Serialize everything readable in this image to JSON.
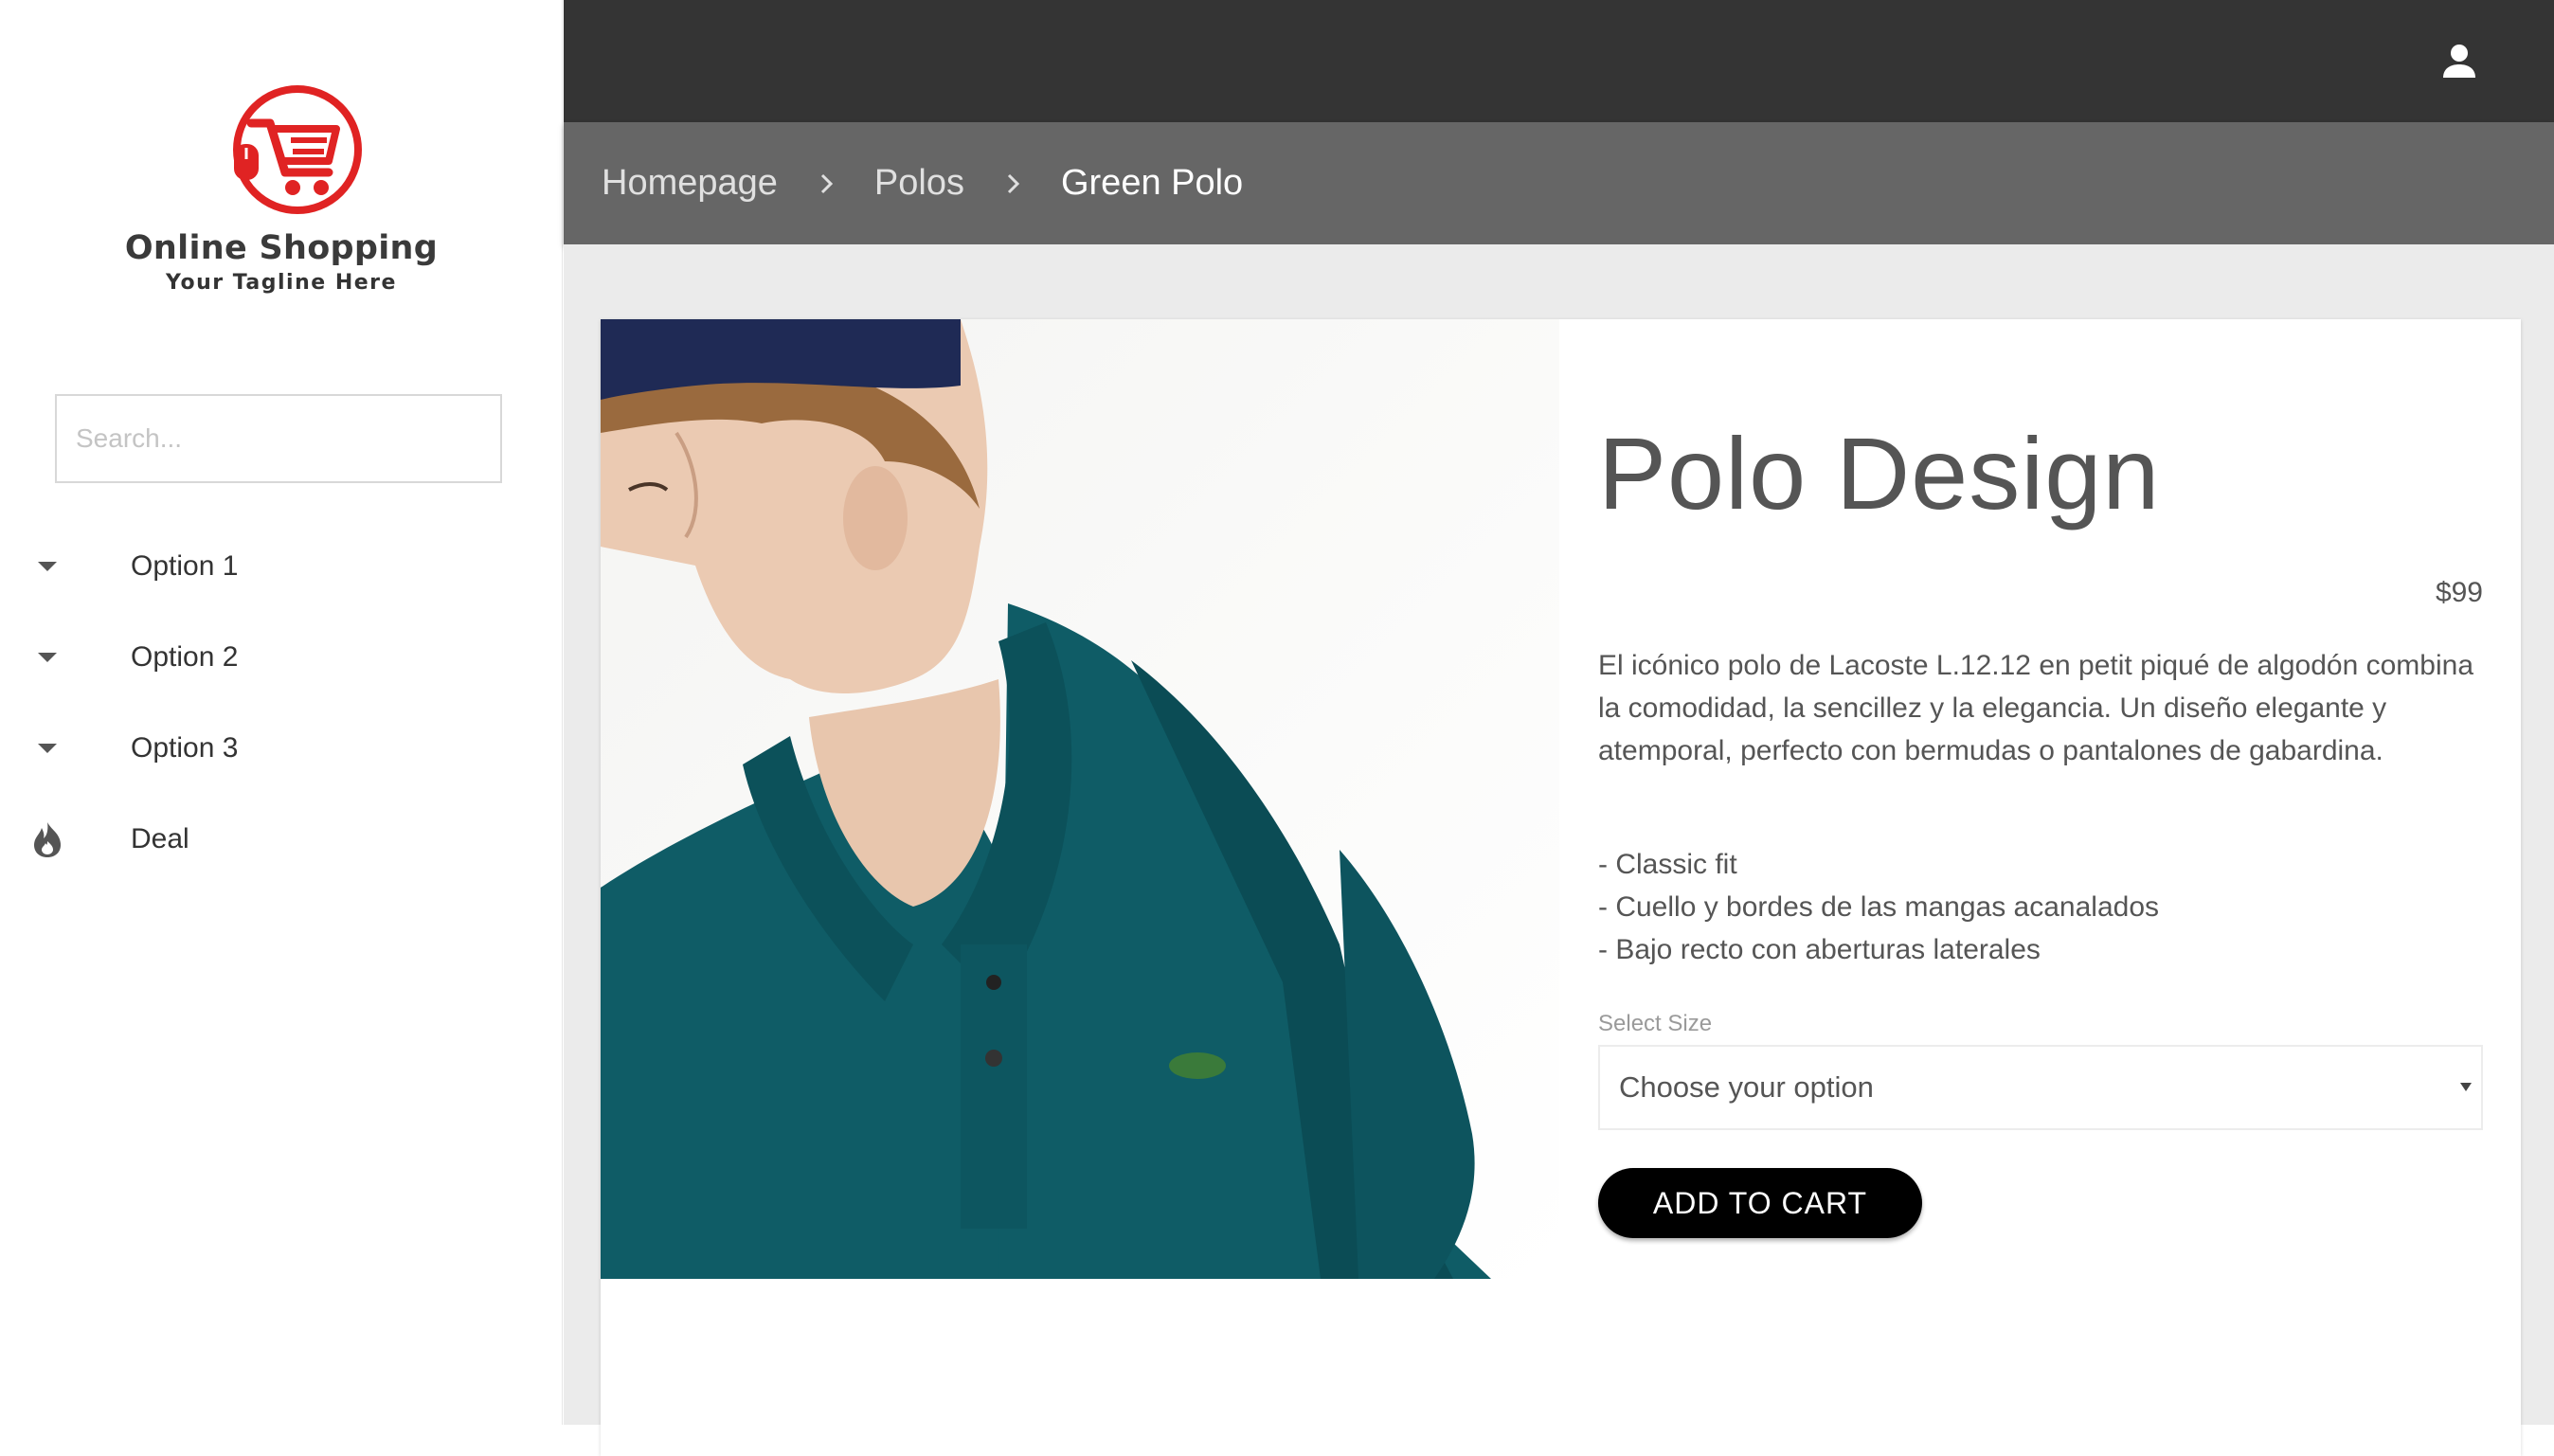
{
  "brand": {
    "name": "Online Shopping",
    "tagline": "Your Tagline Here",
    "logo_icon": "shopping-cart-icon",
    "accent_color": "#e02323"
  },
  "sidebar": {
    "search_placeholder": "Search...",
    "items": [
      {
        "label": "Option 1",
        "icon": "caret-down-icon"
      },
      {
        "label": "Option 2",
        "icon": "caret-down-icon"
      },
      {
        "label": "Option 3",
        "icon": "caret-down-icon"
      },
      {
        "label": "Deal",
        "icon": "fire-icon"
      }
    ]
  },
  "header": {
    "user_icon": "user-icon",
    "background": "#343434"
  },
  "breadcrumb": {
    "items": [
      "Homepage",
      "Polos",
      "Green Polo"
    ],
    "separator_icon": "chevron-right-icon"
  },
  "product": {
    "title": "Polo Design",
    "price": "$99",
    "description": "El icónico polo de Lacoste L.12.12 en petit piqué de algodón combina la comodidad, la sencillez y la elegancia. Un diseño elegante y atemporal, perfecto con bermudas o pantalones de gabardina.",
    "features": [
      "- Classic fit",
      "- Cuello y bordes de las mangas acanalados",
      "- Bajo recto con aberturas laterales"
    ],
    "size_label": "Select Size",
    "size_value": "Choose your option",
    "add_to_cart_label": "ADD TO CART",
    "shirt_color": "#0f5c66"
  }
}
